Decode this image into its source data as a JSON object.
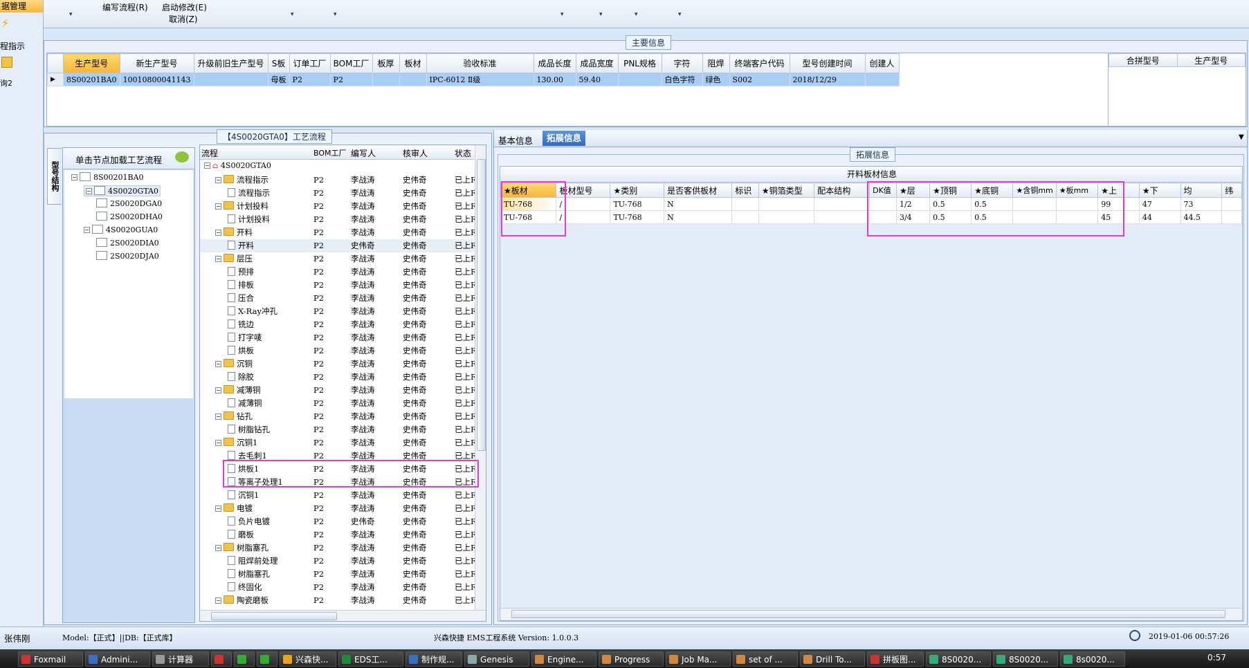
{
  "menu": {
    "item_row1": [
      "编写流程(R)",
      "启动修改(E)"
    ],
    "item_row2": [
      "取消(Z)"
    ]
  },
  "leftnav": {
    "header": "据管理",
    "item1": "程指示",
    "item2": "询2"
  },
  "main_info": {
    "title": "主要信息",
    "columns": [
      "生产型号",
      "新生产型号",
      "升级前旧生产型号",
      "S板",
      "订单工厂",
      "BOM工厂",
      "板厚",
      "板材",
      "验收标准",
      "成品长度",
      "成品宽度",
      "PNL规格",
      "字符",
      "阻焊",
      "终端客户代码",
      "型号创建时间",
      "创建人"
    ],
    "row": [
      "8S00201BA0",
      "10010800041143",
      "",
      "母板",
      "P2",
      "P2",
      "",
      "",
      "IPC-6012 Ⅱ级",
      "130.00",
      "59.40",
      "",
      "白色字符",
      "绿色",
      "S002",
      "2018/12/29",
      ""
    ],
    "right_columns": [
      "合拼型号",
      "生产型号"
    ]
  },
  "process": {
    "title": "【4S0020GTA0】工艺流程",
    "side_tab": "型号结构",
    "hint": "单击节点加载工艺流程",
    "tree": [
      "8S00201BA0",
      "4S0020GTA0",
      "2S0020DGA0",
      "2S0020DHA0",
      "4S0020GUA0",
      "2S0020DIA0",
      "2S0020DJA0"
    ],
    "flow_headers": [
      "流程",
      "BOM工厂",
      "编写人",
      "核审人",
      "状态"
    ],
    "root": "4S0020GTA0",
    "rows": [
      {
        "name": "流程指示",
        "level": 1,
        "bom": "P2",
        "writer": "李战涛",
        "reviewer": "史伟奇",
        "status": "已上R"
      },
      {
        "name": "流程指示",
        "level": 2,
        "bom": "P2",
        "writer": "李战涛",
        "reviewer": "史伟奇",
        "status": "已上R"
      },
      {
        "name": "计划投料",
        "level": 1,
        "bom": "P2",
        "writer": "李战涛",
        "reviewer": "史伟奇",
        "status": "已上R"
      },
      {
        "name": "计划投料",
        "level": 2,
        "bom": "P2",
        "writer": "李战涛",
        "reviewer": "史伟奇",
        "status": "已上R"
      },
      {
        "name": "开料",
        "level": 1,
        "bom": "P2",
        "writer": "李战涛",
        "reviewer": "史伟奇",
        "status": "已上R"
      },
      {
        "name": "开料",
        "level": 2,
        "bom": "P2",
        "writer": "史伟奇",
        "reviewer": "史伟奇",
        "status": "已上R"
      },
      {
        "name": "层压",
        "level": 1,
        "bom": "P2",
        "writer": "李战涛",
        "reviewer": "史伟奇",
        "status": "已上R"
      },
      {
        "name": "预排",
        "level": 2,
        "bom": "P2",
        "writer": "李战涛",
        "reviewer": "史伟奇",
        "status": "已上R"
      },
      {
        "name": "排板",
        "level": 2,
        "bom": "P2",
        "writer": "李战涛",
        "reviewer": "史伟奇",
        "status": "已上R"
      },
      {
        "name": "压合",
        "level": 2,
        "bom": "P2",
        "writer": "李战涛",
        "reviewer": "史伟奇",
        "status": "已上R"
      },
      {
        "name": "X-Ray冲孔",
        "level": 2,
        "bom": "P2",
        "writer": "李战涛",
        "reviewer": "史伟奇",
        "status": "已上R"
      },
      {
        "name": "铣边",
        "level": 2,
        "bom": "P2",
        "writer": "李战涛",
        "reviewer": "史伟奇",
        "status": "已上R"
      },
      {
        "name": "打字唛",
        "level": 2,
        "bom": "P2",
        "writer": "李战涛",
        "reviewer": "史伟奇",
        "status": "已上R"
      },
      {
        "name": "烘板",
        "level": 2,
        "bom": "P2",
        "writer": "李战涛",
        "reviewer": "史伟奇",
        "status": "已上R"
      },
      {
        "name": "沉铜",
        "level": 1,
        "bom": "P2",
        "writer": "李战涛",
        "reviewer": "史伟奇",
        "status": "已上R"
      },
      {
        "name": "除胶",
        "level": 2,
        "bom": "P2",
        "writer": "李战涛",
        "reviewer": "史伟奇",
        "status": "已上R"
      },
      {
        "name": "减薄铜",
        "level": 1,
        "bom": "P2",
        "writer": "李战涛",
        "reviewer": "史伟奇",
        "status": "已上R"
      },
      {
        "name": "减薄铜",
        "level": 2,
        "bom": "P2",
        "writer": "李战涛",
        "reviewer": "史伟奇",
        "status": "已上R"
      },
      {
        "name": "钻孔",
        "level": 1,
        "bom": "P2",
        "writer": "李战涛",
        "reviewer": "史伟奇",
        "status": "已上R"
      },
      {
        "name": "树脂钻孔",
        "level": 2,
        "bom": "P2",
        "writer": "李战涛",
        "reviewer": "史伟奇",
        "status": "已上R"
      },
      {
        "name": "沉铜1",
        "level": 1,
        "bom": "P2",
        "writer": "李战涛",
        "reviewer": "史伟奇",
        "status": "已上R"
      },
      {
        "name": "去毛刺1",
        "level": 2,
        "bom": "P2",
        "writer": "李战涛",
        "reviewer": "史伟奇",
        "status": "已上R"
      },
      {
        "name": "烘板1",
        "level": 2,
        "bom": "P2",
        "writer": "李战涛",
        "reviewer": "史伟奇",
        "status": "已上R"
      },
      {
        "name": "等离子处理1",
        "level": 2,
        "bom": "P2",
        "writer": "李战涛",
        "reviewer": "史伟奇",
        "status": "已上R"
      },
      {
        "name": "沉铜1",
        "level": 2,
        "bom": "P2",
        "writer": "李战涛",
        "reviewer": "史伟奇",
        "status": "已上R"
      },
      {
        "name": "电镀",
        "level": 1,
        "bom": "P2",
        "writer": "李战涛",
        "reviewer": "史伟奇",
        "status": "已上R"
      },
      {
        "name": "负片电镀",
        "level": 2,
        "bom": "P2",
        "writer": "史伟奇",
        "reviewer": "史伟奇",
        "status": "已上R"
      },
      {
        "name": "磨板",
        "level": 2,
        "bom": "P2",
        "writer": "李战涛",
        "reviewer": "史伟奇",
        "status": "已上R"
      },
      {
        "name": "树脂塞孔",
        "level": 1,
        "bom": "P2",
        "writer": "李战涛",
        "reviewer": "史伟奇",
        "status": "已上R"
      },
      {
        "name": "阻焊前处理",
        "level": 2,
        "bom": "P2",
        "writer": "李战涛",
        "reviewer": "史伟奇",
        "status": "已上R"
      },
      {
        "name": "树脂塞孔",
        "level": 2,
        "bom": "P2",
        "writer": "李战涛",
        "reviewer": "史伟奇",
        "status": "已上R"
      },
      {
        "name": "终固化",
        "level": 2,
        "bom": "P2",
        "writer": "李战涛",
        "reviewer": "史伟奇",
        "status": "已上R"
      },
      {
        "name": "陶瓷磨板",
        "level": 1,
        "bom": "P2",
        "writer": "李战涛",
        "reviewer": "史伟奇",
        "status": "已上R"
      }
    ]
  },
  "ext": {
    "tabs": [
      "基本信息",
      "拓展信息"
    ],
    "group_title": "拓展信息",
    "table_title": "开料板材信息",
    "columns": [
      "★板材",
      "板材型号",
      "★类别",
      "是否客供板材",
      "标识",
      "★铜箔类型",
      "配本结构",
      "DK值",
      "★层",
      "★顶铜",
      "★底铜",
      "★含铜mm",
      "★板mm",
      "★上",
      "★下",
      "均",
      "纬"
    ],
    "rows": [
      [
        "TU-768",
        "/",
        "TU-768",
        "N",
        "",
        "",
        "",
        "",
        "1/2",
        "0.5",
        "0.5",
        "",
        "",
        "99",
        "47",
        "73",
        ""
      ],
      [
        "TU-768",
        "/",
        "TU-768",
        "N",
        "",
        "",
        "",
        "",
        "3/4",
        "0.5",
        "0.5",
        "",
        "",
        "45",
        "44",
        "44.5",
        ""
      ]
    ]
  },
  "status": {
    "user": "张伟刚",
    "model_db": "Model:【正式】||DB:【正式库】",
    "app": "兴森快捷 EMS工程系统 Version: 1.0.0.3",
    "datetime": "2019-01-06 00:57:26"
  },
  "taskbar": {
    "items": [
      "Foxmail",
      "Admini...",
      "计算器",
      "",
      "",
      "",
      "兴森快...",
      "EDS工...",
      "制作规...",
      "Genesis",
      "Engine...",
      "Progress",
      "Job Ma...",
      "set of ...",
      "Drill To...",
      "拼板图...",
      "8S0020...",
      "8S0020...",
      "8s0020..."
    ],
    "clock": "0:57"
  },
  "colors": {
    "highlight": "#e03ad6",
    "selected_row": "#a9cdf3",
    "active_tab": "#3a78c8"
  }
}
